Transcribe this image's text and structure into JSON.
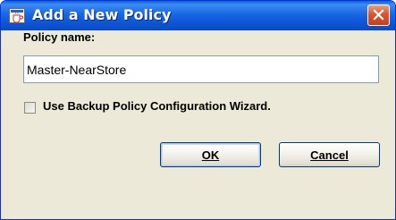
{
  "window": {
    "title": "Add a New Policy",
    "icons": {
      "app": "java-cup-icon",
      "close": "close-x-icon"
    }
  },
  "form": {
    "policy_name_label": "Policy name:",
    "policy_name_value": "Master-NearStore",
    "wizard_checkbox_label": "Use Backup Policy Configuration Wizard.",
    "wizard_checked": false
  },
  "buttons": {
    "ok_label": "OK",
    "cancel_label": "Cancel"
  },
  "colors": {
    "titlebar": "#0b52d1",
    "close_button": "#d9552b",
    "dialog_background": "#ece9d8"
  }
}
